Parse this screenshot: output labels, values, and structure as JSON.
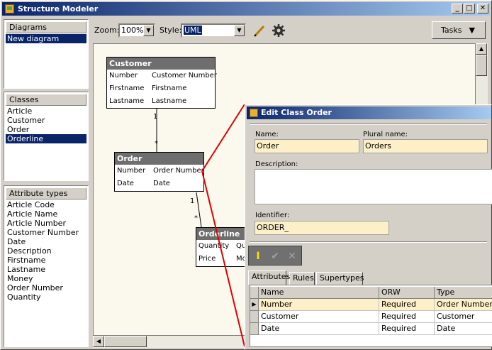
{
  "window": {
    "title": "Structure Modeler",
    "minimize": "_",
    "maximize": "□",
    "close": "✕",
    "icon": "box-icon"
  },
  "diagrams": {
    "header": "Diagrams",
    "items": [
      "New diagram"
    ],
    "selected": 0
  },
  "classes": {
    "header": "Classes",
    "items": [
      "Article",
      "Customer",
      "Order",
      "Orderline"
    ],
    "selected": 3
  },
  "attribute_types": {
    "header": "Attribute types",
    "items": [
      "Article Code",
      "Article Name",
      "Article Number",
      "Customer Number",
      "Date",
      "Description",
      "Firstname",
      "Lastname",
      "Money",
      "Order Number",
      "Quantity"
    ]
  },
  "toolbar": {
    "zoom_label": "Zoom:",
    "zoom_value": "100%",
    "style_label": "Style:",
    "style_value": "UML",
    "tasks_label": "Tasks",
    "tasks_arrow": "▼",
    "combo_arrow": "▼",
    "pencil_icon": "pencil-icon",
    "gear_icon": "gear-icon"
  },
  "diagram": {
    "classes": [
      {
        "name": "Customer",
        "rows": [
          [
            "Number",
            "Customer Number"
          ],
          [
            "Firstname",
            "Firstname"
          ],
          [
            "Lastname",
            "Lastname"
          ]
        ]
      },
      {
        "name": "Order",
        "rows": [
          [
            "Number",
            "Order Number"
          ],
          [
            "Date",
            "Date"
          ]
        ]
      },
      {
        "name": "Orderline",
        "rows": [
          [
            "Quantity",
            "Qu"
          ],
          [
            "Price",
            "Mo"
          ]
        ]
      }
    ],
    "multiplicities": [
      "1",
      "*",
      "1",
      "*"
    ]
  },
  "dialog": {
    "title": "Edit Class Order",
    "name_label": "Name:",
    "name_value": "Order",
    "plural_label": "Plural name:",
    "plural_value": "Orders",
    "description_label": "Description:",
    "description_value": "",
    "identifier_label": "Identifier:",
    "identifier_value": "ORDER_",
    "edit_icons": [
      "cursor-icon",
      "check-icon",
      "cross-icon"
    ],
    "edit_glyphs": [
      "I",
      "✔",
      "✕"
    ],
    "tabs": [
      "Attributes",
      "Rules",
      "Supertypes"
    ],
    "active_tab": 0,
    "grid": {
      "columns": [
        "Name",
        "ORW",
        "Type"
      ],
      "rows": [
        [
          "Number",
          "Required",
          "Order Number"
        ],
        [
          "Customer",
          "Required",
          "Customer"
        ],
        [
          "Date",
          "Required",
          "Date"
        ]
      ],
      "current_row": 0,
      "row_indicator": "▶"
    }
  },
  "colors": {
    "title_gradient_start": "#0a246a",
    "title_gradient_end": "#a6caf0",
    "selection": "#0a246a",
    "canvas": "#fbf9ee",
    "class_header": "#6e6e6e",
    "field_bg": "#fdf0c8",
    "red_line": "#e00000"
  }
}
